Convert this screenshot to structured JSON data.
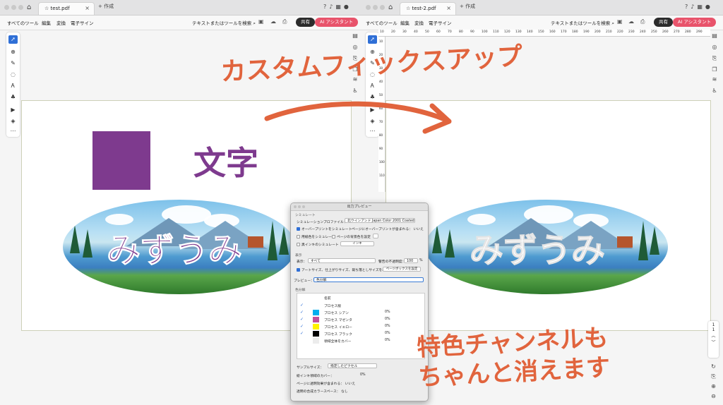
{
  "windows": [
    {
      "tab_title": "test.pdf",
      "new_tab_label": "作成",
      "menu": [
        "すべてのツール",
        "編集",
        "変換",
        "電子サイン"
      ],
      "search_label": "テキストまたはツールを検索",
      "share_label": "共有",
      "ai_label": "AI アシスタント"
    },
    {
      "tab_title": "test-2.pdf",
      "new_tab_label": "作成",
      "menu": [
        "すべてのツール",
        "編集",
        "変換",
        "電子サイン"
      ],
      "search_label": "テキストまたはツールを検索",
      "share_label": "共有",
      "ai_label": "AI アシスタント"
    }
  ],
  "document": {
    "heading_text": "文字",
    "lake_text": "みずうみ",
    "square_color": "#7e3a8e",
    "text_color": "#7e3a8e"
  },
  "ruler_top_ticks": [
    "10",
    "20",
    "30",
    "40",
    "50",
    "60",
    "70",
    "80",
    "90",
    "100",
    "110",
    "120",
    "130",
    "140",
    "150",
    "160",
    "170",
    "180",
    "190",
    "200",
    "210",
    "220",
    "230",
    "240",
    "250",
    "260",
    "270",
    "280",
    "290"
  ],
  "ruler_left_ticks": [
    "10",
    "20",
    "30",
    "40",
    "50",
    "60",
    "70",
    "80",
    "90",
    "100",
    "110"
  ],
  "zoom": {
    "page_num": "1",
    "page_total": "1"
  },
  "dialog": {
    "title": "出力プレビュー",
    "section_simulate": "シミュレート",
    "sim_profile_label": "シミュレーションプロファイル：",
    "sim_profile_value": "北ウインアンド Japan Color 2001 Coated",
    "overprint_label": "オーバープリントをシミュレート",
    "page_has_overprint": "ページにオーバープリントが含まれる：",
    "page_has_overprint_value": "いいえ",
    "paper_color_label": "用紙色をシミュレート",
    "page_bg_label": "ページの背景色を設定",
    "black_ink_label": "黒インキのシミュレート",
    "ink_button": "インキ",
    "section_display": "表示",
    "display_label": "表示：",
    "display_value": "すべて",
    "warning_opacity_label": "警告の不透明度：",
    "warning_opacity_value": "100",
    "percent": "%",
    "artsize_label": "アートサイズ、仕上がりサイズ、裁ち落としサイズを表示",
    "pagebox_button": "ページボックスを設定",
    "preview_label": "プレビュー：",
    "preview_value": "色分解",
    "section_separation": "色分解",
    "col_name": "名前",
    "inks": [
      {
        "name": "プロセス版",
        "color": "#ffffff",
        "checked": true,
        "pct": ""
      },
      {
        "name": "プロセス シアン",
        "color": "#00aeef",
        "checked": true,
        "pct": "0%"
      },
      {
        "name": "プロセス マゼンタ",
        "color": "#c04f9d",
        "checked": true,
        "pct": "0%"
      },
      {
        "name": "プロセス イエロー",
        "color": "#fff200",
        "checked": true,
        "pct": "0%"
      },
      {
        "name": "プロセス ブラック",
        "color": "#000000",
        "checked": true,
        "pct": "0%"
      },
      {
        "name": "領域全体をカバー",
        "color": "#ececec",
        "checked": false,
        "pct": "0%"
      }
    ],
    "sample_size_label": "サンプルサイズ：",
    "sample_size_value": "指定したピクセル",
    "total_ink_label": "総インキ領域のカバー：",
    "total_ink_value": "0%",
    "page_spot_label": "ページに透明効果が含まれる：",
    "page_spot_value": "いいえ",
    "blend_space_label": "透明の合成カラースペース：",
    "blend_space_value": "なし"
  },
  "annotations": {
    "top": "カスタムフィックスアップ",
    "bottom_line1": "特色チャンネルも",
    "bottom_line2": "ちゃんと消えます",
    "color": "#e1643d"
  },
  "icons": [
    "home-icon",
    "star-icon",
    "help-icon",
    "bell-icon",
    "apps-icon",
    "avatar-icon",
    "search-icon",
    "select-tool-icon",
    "zoom-tool-icon",
    "pen-tool-icon",
    "lasso-tool-icon",
    "text-tool-icon",
    "stamp-tool-icon",
    "video-tool-icon",
    "fix-tool-icon",
    "more-icon"
  ]
}
